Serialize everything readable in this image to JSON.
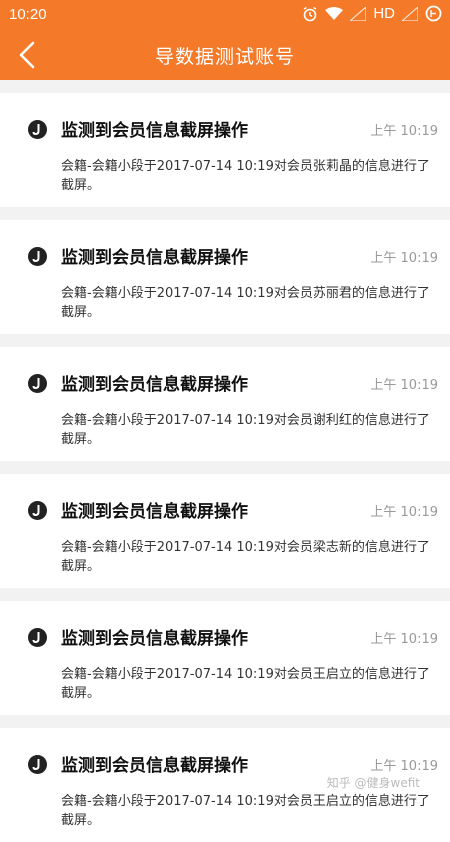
{
  "status": {
    "time": "10:20",
    "network": "HD",
    "battery_icon": "battery-icon"
  },
  "header": {
    "title": "导数据测试账号",
    "back_icon": "back-arrow-icon",
    "color": "#f47a2a"
  },
  "notifications": [
    {
      "title": "监测到会员信息截屏操作",
      "time": "上午 10:19",
      "body": "会籍-会籍小段于2017-07-14 10:19对会员张莉晶的信息进行了截屏。"
    },
    {
      "title": "监测到会员信息截屏操作",
      "time": "上午 10:19",
      "body": "会籍-会籍小段于2017-07-14 10:19对会员苏丽君的信息进行了截屏。"
    },
    {
      "title": "监测到会员信息截屏操作",
      "time": "上午 10:19",
      "body": "会籍-会籍小段于2017-07-14 10:19对会员谢利红的信息进行了截屏。"
    },
    {
      "title": "监测到会员信息截屏操作",
      "time": "上午 10:19",
      "body": "会籍-会籍小段于2017-07-14 10:19对会员梁志新的信息进行了截屏。"
    },
    {
      "title": "监测到会员信息截屏操作",
      "time": "上午 10:19",
      "body": "会籍-会籍小段于2017-07-14 10:19对会员王启立的信息进行了截屏。"
    },
    {
      "title": "监测到会员信息截屏操作",
      "time": "上午 10:19",
      "body": "会籍-会籍小段于2017-07-14 10:19对会员王启立的信息进行了截屏。"
    }
  ],
  "watermark": "知乎 @健身wefit"
}
